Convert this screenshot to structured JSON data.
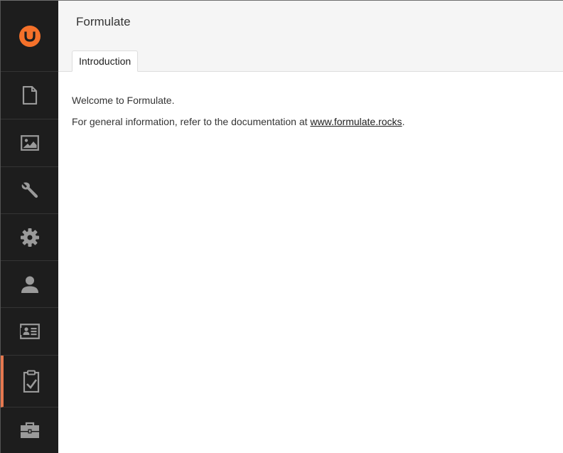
{
  "header": {
    "title": "Formulate"
  },
  "tabs": [
    {
      "label": "Introduction",
      "active": true
    }
  ],
  "content": {
    "welcome": "Welcome to Formulate.",
    "info_prefix": "For general information, refer to the documentation at ",
    "link_text": "www.formulate.rocks",
    "info_suffix": "."
  },
  "sidebar": {
    "logo": "umbraco-logo",
    "items": [
      {
        "icon": "document-icon",
        "active": false
      },
      {
        "icon": "image-icon",
        "active": false
      },
      {
        "icon": "wrench-icon",
        "active": false
      },
      {
        "icon": "gear-icon",
        "active": false
      },
      {
        "icon": "user-icon",
        "active": false
      },
      {
        "icon": "id-card-icon",
        "active": false
      },
      {
        "icon": "clipboard-check-icon",
        "active": true
      },
      {
        "icon": "briefcase-icon",
        "active": false
      }
    ]
  },
  "colors": {
    "sidebar_bg": "#1d1d1d",
    "accent": "#e5784f",
    "logo": "#f5712a",
    "icon": "#9a9a9a",
    "header_bg": "#f5f5f5"
  }
}
